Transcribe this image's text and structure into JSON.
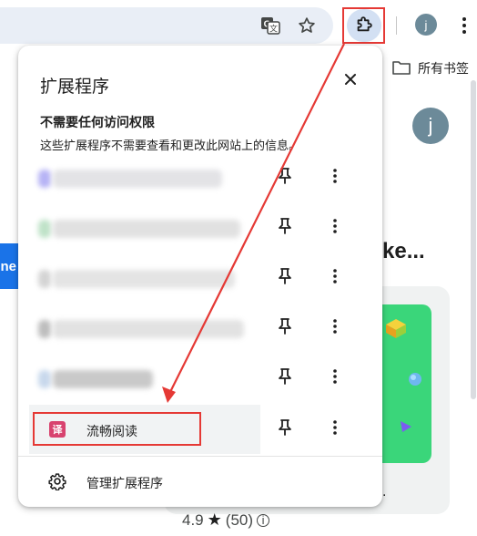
{
  "toolbar": {
    "profile_initial": "j",
    "icons": [
      "translate-icon",
      "star-icon",
      "extensions-puzzle-icon",
      "kebab-menu-icon"
    ]
  },
  "bookmarks": {
    "folder_label": "所有书签"
  },
  "page": {
    "profile_initial": "j",
    "blue_tab_text": "ne",
    "heading": "ke...",
    "rating": "4.9",
    "rating_count": "(50)",
    "dot_text": "."
  },
  "extensions_popup": {
    "title": "扩展程序",
    "section_heading": "不需要任何访问权限",
    "section_description": "这些扩展程序不需要查看和更改此网站上的信息。",
    "hidden_extensions": [
      {
        "colors": [
          "#b6b3f5",
          "#e3e3e6"
        ]
      },
      {
        "colors": [
          "#bfe2c8",
          "#e1e1e1"
        ]
      },
      {
        "colors": [
          "#d4d4d4",
          "#e4e4e4"
        ]
      },
      {
        "colors": [
          "#bdbdbd",
          "#e2e2e2"
        ]
      },
      {
        "colors": [
          "#c8d8ec",
          "#c9c9c9"
        ]
      }
    ],
    "visible_extension": {
      "icon_glyph": "译",
      "name": "流畅阅读",
      "icon_color": "#d8436f"
    },
    "manage_label": "管理扩展程序"
  },
  "annotation_color": "#e53935"
}
